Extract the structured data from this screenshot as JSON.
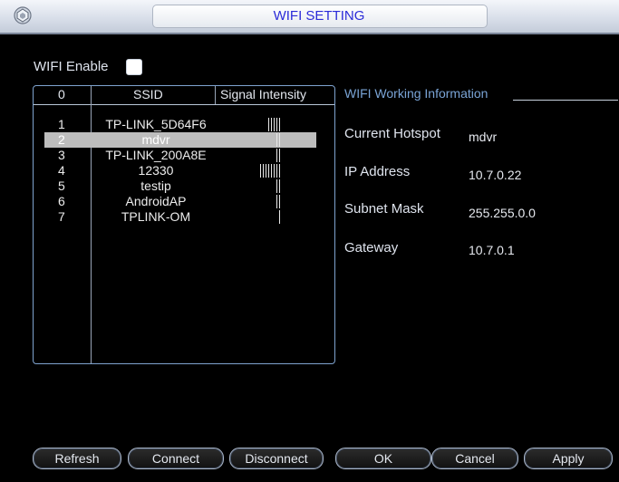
{
  "window": {
    "title": "WIFI SETTING"
  },
  "wifi_enable": {
    "label": "WIFI Enable",
    "checked": false
  },
  "network_list": {
    "columns": [
      "0",
      "SSID",
      "Signal Intensity"
    ],
    "rows": [
      {
        "num": "1",
        "ssid": "TP-LINK_5D64F6",
        "signal": 5
      },
      {
        "num": "2",
        "ssid": "mdvr",
        "signal": 2
      },
      {
        "num": "3",
        "ssid": "TP-LINK_200A8E",
        "signal": 2
      },
      {
        "num": "4",
        "ssid": "12330",
        "signal": 8
      },
      {
        "num": "5",
        "ssid": "testip",
        "signal": 2
      },
      {
        "num": "6",
        "ssid": "AndroidAP",
        "signal": 2
      },
      {
        "num": "7",
        "ssid": "TPLINK-OM",
        "signal": 1
      }
    ],
    "selected_index": 1
  },
  "info": {
    "title": "WIFI Working Information",
    "current_hotspot_label": "Current Hotspot",
    "current_hotspot": "mdvr",
    "ip_label": "IP Address",
    "ip": "10.7.0.22",
    "subnet_label": "Subnet Mask",
    "subnet": "255.255.0.0",
    "gateway_label": "Gateway",
    "gateway": "10.7.0.1"
  },
  "buttons": {
    "refresh": "Refresh",
    "connect": "Connect",
    "disconnect": "Disconnect",
    "ok": "OK",
    "cancel": "Cancel",
    "apply": "Apply"
  },
  "colors": {
    "title_text": "#2b2bd8",
    "info_title": "#7aa4d6",
    "list_border": "#7fa3cf",
    "selected_row": "#bdbdbd"
  }
}
